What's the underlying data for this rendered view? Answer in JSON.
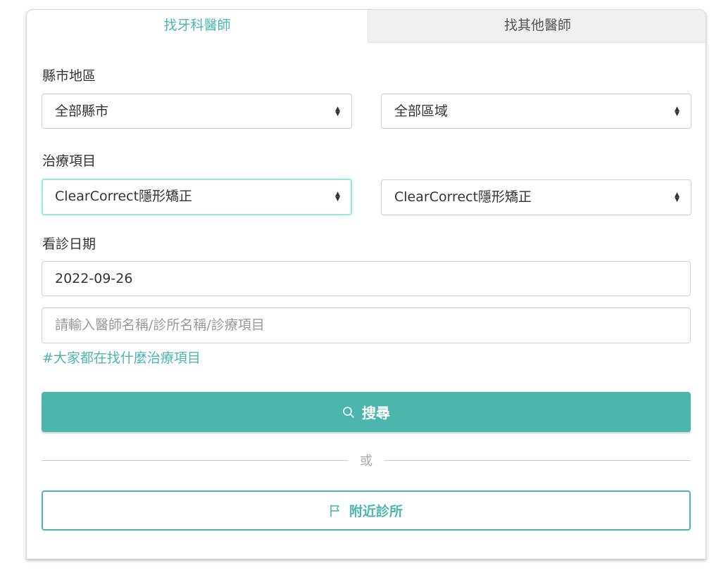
{
  "tabs": {
    "dentist": "找牙科醫師",
    "other": "找其他醫師"
  },
  "region": {
    "label": "縣市地區",
    "city_value": "全部縣市",
    "district_value": "全部區域"
  },
  "treatment": {
    "label": "治療項目",
    "primary_value": "ClearCorrect隱形矯正",
    "secondary_value": "ClearCorrect隱形矯正"
  },
  "date": {
    "label": "看診日期",
    "value": "2022-09-26"
  },
  "keyword": {
    "placeholder": "請輸入醫師名稱/診所名稱/診療項目"
  },
  "popular_link": "#大家都在找什麼治療項目",
  "search_button": {
    "label": "搜尋",
    "icon": "search-icon"
  },
  "divider_text": "或",
  "nearby_button": {
    "label": "附近診所",
    "icon": "flag-icon"
  },
  "colors": {
    "accent": "#4db6ac",
    "tab_inactive_bg": "#efefef"
  }
}
